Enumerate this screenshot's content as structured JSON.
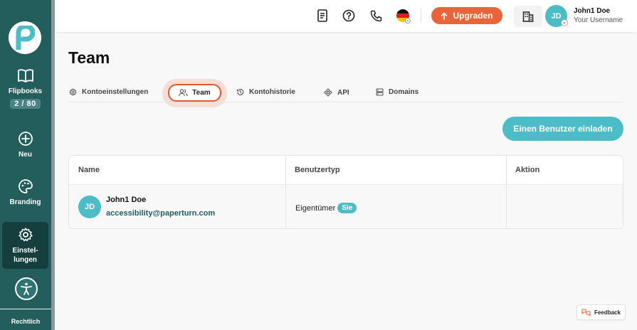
{
  "sidebar": {
    "items": [
      {
        "label": "Flipbooks",
        "badge": "2 / 80",
        "icon": "book-open-icon"
      },
      {
        "label": "Neu",
        "icon": "plus-circle-icon"
      },
      {
        "label": "Branding",
        "icon": "palette-icon"
      },
      {
        "label": "Einstel-\nlungen",
        "label_line1": "Einstel-",
        "label_line2": "lungen",
        "icon": "gear-icon",
        "active": true
      }
    ],
    "legal_label": "Rechtlich"
  },
  "topbar": {
    "upgrade_label": "Upgraden",
    "user": {
      "initials": "JD",
      "name": "John1 Doe",
      "subtitle": "Your Username"
    }
  },
  "page": {
    "title": "Team"
  },
  "tabs": [
    {
      "label": "Kontoeinstellungen",
      "icon": "gear-icon"
    },
    {
      "label": "Team",
      "icon": "users-icon",
      "active": true
    },
    {
      "label": "Kontohistorie",
      "icon": "history-icon"
    },
    {
      "label": "API",
      "icon": "api-icon"
    },
    {
      "label": "Domains",
      "icon": "server-icon"
    }
  ],
  "invite_button": "Einen Benutzer einladen",
  "table": {
    "headers": [
      "Name",
      "Benutzertyp",
      "Aktion"
    ],
    "rows": [
      {
        "initials": "JD",
        "name": "John1 Doe",
        "email": "accessibility@paperturn.com",
        "type": "Eigentümer",
        "badge": "Sie"
      }
    ]
  },
  "feedback_label": "Feedback",
  "colors": {
    "sidebar": "#235d5c",
    "accent": "#4cbcc6",
    "upgrade": "#e8653a",
    "active_tab_border": "#e0582b"
  }
}
